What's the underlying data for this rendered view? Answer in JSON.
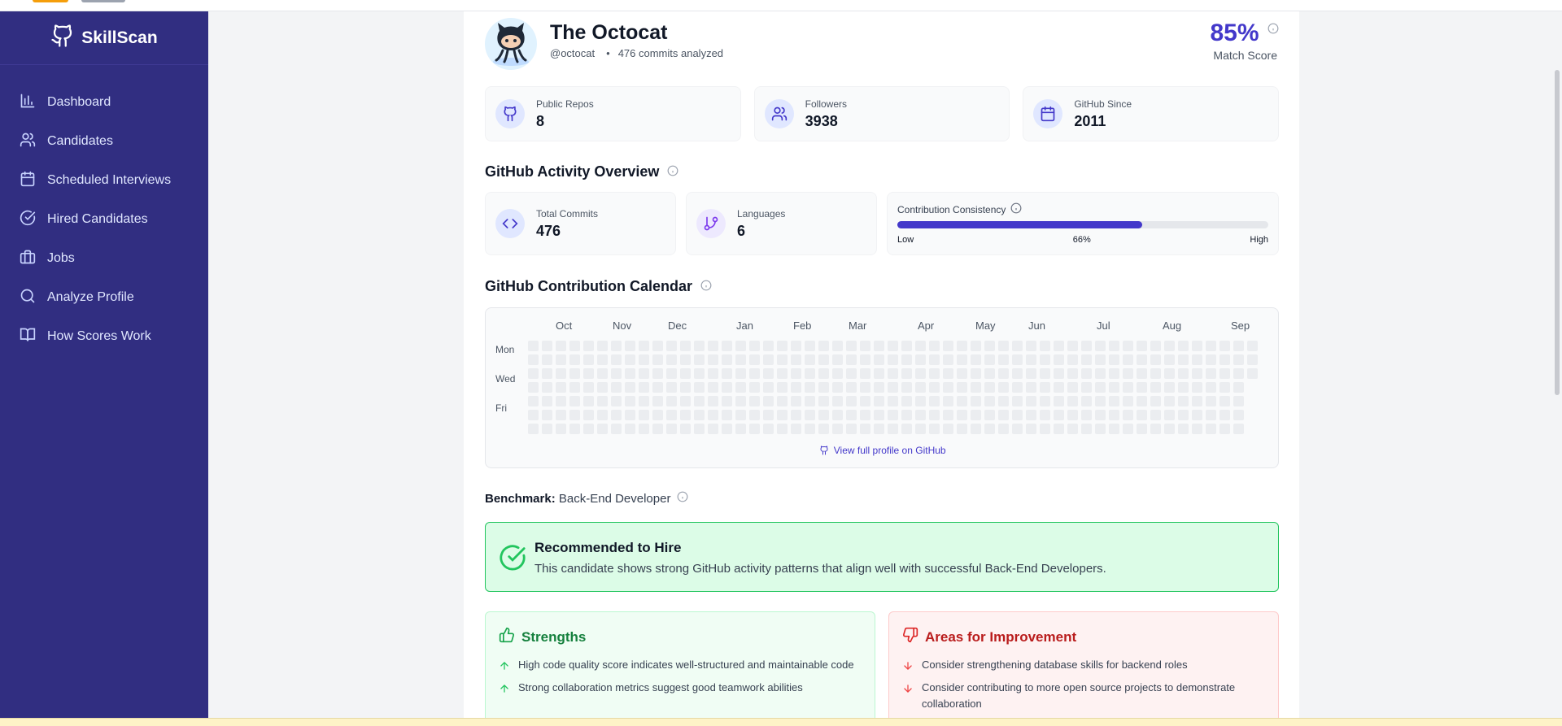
{
  "app": {
    "name": "SkillScan"
  },
  "sidebar": {
    "items": [
      {
        "label": "Dashboard",
        "icon": "bar-chart-icon"
      },
      {
        "label": "Candidates",
        "icon": "users-icon"
      },
      {
        "label": "Scheduled Interviews",
        "icon": "calendar-icon"
      },
      {
        "label": "Hired Candidates",
        "icon": "check-circle-icon"
      },
      {
        "label": "Jobs",
        "icon": "briefcase-icon"
      },
      {
        "label": "Analyze Profile",
        "icon": "search-icon"
      },
      {
        "label": "How Scores Work",
        "icon": "book-icon"
      }
    ]
  },
  "profile": {
    "name": "The Octocat",
    "handle": "@octocat",
    "dot": "•",
    "commits_analyzed": "476 commits analyzed",
    "score": "85%",
    "score_label": "Match Score"
  },
  "stats": {
    "public_repos": {
      "label": "Public Repos",
      "value": "8"
    },
    "followers": {
      "label": "Followers",
      "value": "3938"
    },
    "github_since": {
      "label": "GitHub Since",
      "value": "2011"
    }
  },
  "activity": {
    "title": "GitHub Activity Overview",
    "total_commits": {
      "label": "Total Commits",
      "value": "476"
    },
    "languages": {
      "label": "Languages",
      "value": "6"
    },
    "consistency": {
      "label": "Contribution Consistency",
      "percent": 66,
      "percent_label": "66%",
      "low": "Low",
      "high": "High"
    }
  },
  "calendar": {
    "title": "GitHub Contribution Calendar",
    "months": [
      "Oct",
      "Nov",
      "Dec",
      "Jan",
      "Feb",
      "Mar",
      "Apr",
      "May",
      "Jun",
      "Jul",
      "Aug",
      "Sep"
    ],
    "days": [
      "Mon",
      "Wed",
      "Fri"
    ],
    "link": "View full profile on GitHub"
  },
  "benchmark": {
    "label": "Benchmark:",
    "value": "Back-End Developer"
  },
  "recommendation": {
    "title": "Recommended to Hire",
    "description": "This candidate shows strong GitHub activity patterns that align well with successful Back-End Developers."
  },
  "strengths": {
    "title": "Strengths",
    "items": [
      "High code quality score indicates well-structured and maintainable code",
      "Strong collaboration metrics suggest good teamwork abilities"
    ]
  },
  "improvements": {
    "title": "Areas for Improvement",
    "items": [
      "Consider strengthening database skills for backend roles",
      "Consider contributing to more open source projects to demonstrate collaboration"
    ]
  },
  "colors": {
    "sidebar": "#312e81",
    "accent": "#4338ca",
    "success": "#22c55e",
    "danger": "#b91c1c"
  }
}
